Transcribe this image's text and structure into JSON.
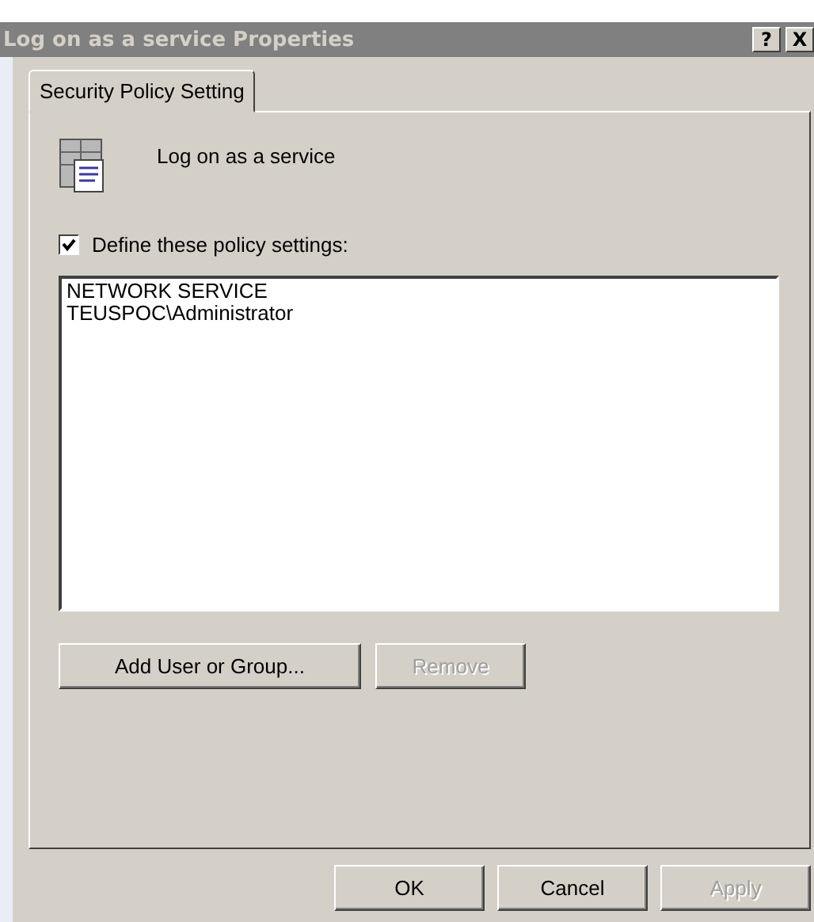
{
  "window": {
    "title": "Log on as a service Properties",
    "help_button": "?",
    "close_button": "X"
  },
  "tabs": [
    {
      "label": "Security Policy Setting",
      "selected": true
    }
  ],
  "policy": {
    "name": "Log on as a service"
  },
  "define_checkbox": {
    "label": "Define these policy settings:",
    "checked": true
  },
  "accounts": [
    "NETWORK SERVICE",
    "TEUSPOC\\Administrator"
  ],
  "list_buttons": [
    {
      "label": "Add User or Group...",
      "disabled": false
    },
    {
      "label": "Remove",
      "disabled": true
    }
  ],
  "dialog_buttons": [
    {
      "label": "OK",
      "disabled": false
    },
    {
      "label": "Cancel",
      "disabled": false
    },
    {
      "label": "Apply",
      "disabled": true
    }
  ]
}
